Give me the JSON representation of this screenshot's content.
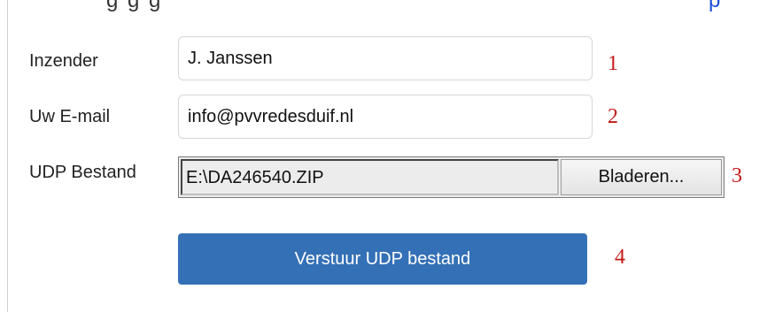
{
  "header_fragment": {
    "text": "g g g",
    "link_text": "p"
  },
  "form": {
    "sender": {
      "label": "Inzender",
      "value": "J. Janssen",
      "number": "1"
    },
    "email": {
      "label": "Uw E-mail",
      "value": "info@pvvredesduif.nl",
      "number": "2"
    },
    "file": {
      "label": "UDP Bestand",
      "value": "E:\\DA246540.ZIP",
      "browse_label": "Bladeren...",
      "number": "3"
    },
    "submit": {
      "label": "Verstuur UDP bestand",
      "number": "4"
    }
  },
  "colors": {
    "button_bg": "#3470b6",
    "annotation": "#c41818",
    "link": "#1a4fd6"
  }
}
